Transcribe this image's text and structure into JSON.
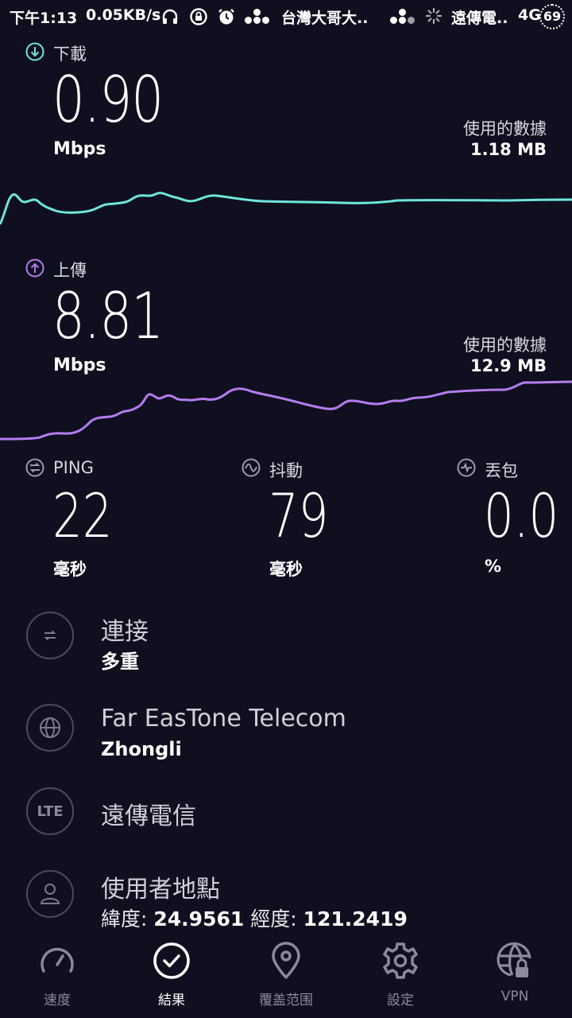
{
  "status_bar": {
    "time": "下午1:13",
    "speed": "0.05KB/s",
    "carrier1": "台灣大哥大..",
    "carrier2": "遠傳電..",
    "network": "4G",
    "battery": "69"
  },
  "download": {
    "label": "下載",
    "value": "0.90",
    "unit": "Mbps",
    "data_used_label": "使用的數據",
    "data_used_value": "1.18 MB",
    "color": "#6fe6da"
  },
  "upload": {
    "label": "上傳",
    "value": "8.81",
    "unit": "Mbps",
    "data_used_label": "使用的數據",
    "data_used_value": "12.9 MB",
    "color": "#b57cf0"
  },
  "metrics": {
    "ping": {
      "label": "PING",
      "value": "22",
      "unit": "毫秒"
    },
    "jitter": {
      "label": "抖動",
      "value": "79",
      "unit": "毫秒"
    },
    "loss": {
      "label": "丟包",
      "value": "0.0",
      "unit": "%"
    }
  },
  "info": {
    "connection": {
      "title": "連接",
      "value": "多重"
    },
    "provider": {
      "title": "Far EasTone Telecom",
      "value": "Zhongli"
    },
    "network": {
      "badge": "LTE",
      "title": "遠傳電信"
    },
    "location": {
      "title": "使用者地點",
      "lat_label": "緯度:",
      "lat_value": "24.9561",
      "lon_label": "經度:",
      "lon_value": "121.2419"
    }
  },
  "nav": {
    "speed": "速度",
    "results": "結果",
    "coverage": "覆盖范围",
    "settings": "設定",
    "vpn": "VPN"
  }
}
